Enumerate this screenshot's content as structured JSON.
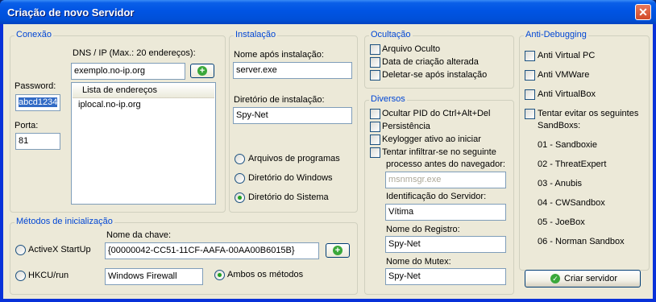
{
  "window": {
    "title": "Criação de novo Servidor"
  },
  "conexao": {
    "group_label": "Conexão",
    "dns_label": "DNS / IP (Max.: 20 endereços):",
    "dns_value": "exemplo.no-ip.org",
    "password_label": "Password:",
    "password_value": "abcd1234",
    "porta_label": "Porta:",
    "porta_value": "81",
    "list_header": "Lista de endereços",
    "addresses": [
      "iplocal.no-ip.org"
    ]
  },
  "instalacao": {
    "group_label": "Instalação",
    "name_label": "Nome após instalação:",
    "name_value": "server.exe",
    "dir_label": "Diretório de instalação:",
    "dir_value": "Spy-Net",
    "options": [
      "Arquivos de programas",
      "Diretório do Windows",
      "Diretório do Sistema"
    ],
    "selected_option": "Diretório do Sistema"
  },
  "ocultacao": {
    "group_label": "Ocultação",
    "options": [
      "Arquivo Oculto",
      "Data de criação alterada",
      "Deletar-se após instalação"
    ]
  },
  "diversos": {
    "group_label": "Diversos",
    "options": [
      "Ocultar PID do Ctrl+Alt+Del",
      "Persistência",
      "Keylogger ativo ao iniciar"
    ],
    "infiltrate_line1": "Tentar infiltrar-se no seguinte",
    "infiltrate_line2": "processo antes do navegador:",
    "process_value": "msnmsgr.exe",
    "server_id_label": "Identificação do Servidor:",
    "server_id_value": "Vítima",
    "registry_label": "Nome do Registro:",
    "registry_value": "Spy-Net",
    "mutex_label": "Nome do Mutex:",
    "mutex_value": "Spy-Net"
  },
  "anti": {
    "group_label": "Anti-Debugging",
    "options": [
      "Anti Virtual PC",
      "Anti VMWare",
      "Anti VirtualBox"
    ],
    "sandbox_line1": "Tentar evitar os seguintes",
    "sandbox_line2": "SandBoxs:",
    "sandboxes": [
      "01 - Sandboxie",
      "02 - ThreatExpert",
      "03 - Anubis",
      "04 - CWSandbox",
      "05 - JoeBox",
      "06 - Norman Sandbox"
    ],
    "create_button": "Criar servidor"
  },
  "metodos": {
    "group_label": "Métodos de inicialização",
    "activex_label": "ActiveX StartUp",
    "key_label": "Nome da chave:",
    "key_value": "{00000042-CC51-11CF-AAFA-00AA00B6015B}",
    "hkcu_label": "HKCU/run",
    "hkcu_value": "Windows Firewall",
    "both_label": "Ambos os métodos",
    "selected": "Ambos os métodos"
  }
}
